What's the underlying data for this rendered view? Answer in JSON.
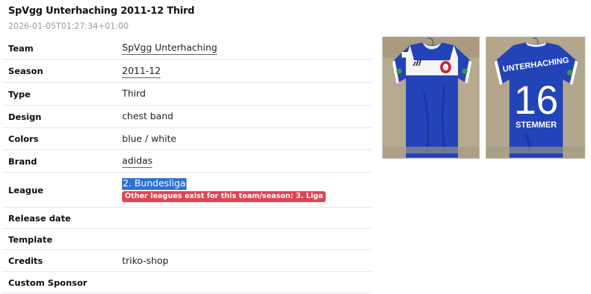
{
  "header": {
    "title": "SpVgg Unterhaching 2011-12 Third",
    "timestamp": "2026-01-05T01:27:34+01:00"
  },
  "details": {
    "team": {
      "label": "Team",
      "value": "SpVgg Unterhaching"
    },
    "season": {
      "label": "Season",
      "value": "2011-12"
    },
    "type": {
      "label": "Type",
      "value": "Third"
    },
    "design": {
      "label": "Design",
      "value": "chest band"
    },
    "colors": {
      "label": "Colors",
      "value": "blue / white"
    },
    "brand": {
      "label": "Brand",
      "value": "adidas"
    },
    "league": {
      "label": "League",
      "value": "2. Bundesliga",
      "warning": "Other leagues exist for this team/season: 3. Liga"
    },
    "release_date": {
      "label": "Release date",
      "value": ""
    },
    "template": {
      "label": "Template",
      "value": ""
    },
    "credits": {
      "label": "Credits",
      "value": "triko-shop"
    },
    "custom_sponsor": {
      "label": "Custom Sponsor",
      "value": ""
    }
  },
  "photos": {
    "back": {
      "name_text": "UNTERHACHING",
      "number": "16",
      "player": "STEMMER"
    }
  },
  "colors": {
    "shirt_blue": "#2244b8",
    "band_white": "#ffffff",
    "highlight": "#2f6fd6",
    "warning": "#e04452"
  }
}
